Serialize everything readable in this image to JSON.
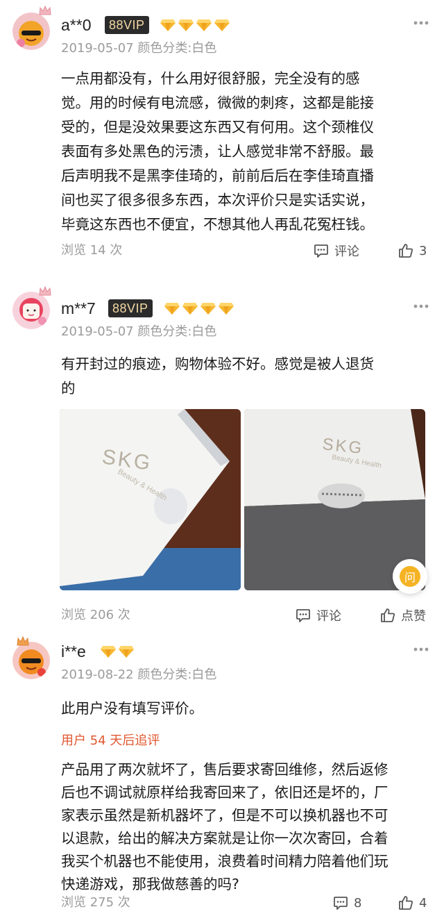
{
  "reviews": [
    {
      "username": "a**0",
      "vip_badge": "88VIP",
      "diamond_count": 4,
      "meta": "2019-05-07 颜色分类:白色",
      "lines": [
        "一点用都没有，什么用好很舒服，完全没有的感",
        "觉。用的时候有电流感，微微的刺疼，这都是能接",
        "受的，但是没效果要这东西又有何用。这个颈椎仪",
        "表面有多处黑色的污渍，让人感觉非常不舒服。最",
        "后声明我不是黑李佳琦的，前前后后在李佳琦直播",
        "间也买了很多很多东西，本次评价只是实话实说，",
        "毕竟这东西也不便宜，不想其他人再乱花冤枉钱。"
      ],
      "views": "浏览 14 次",
      "comment_label": "评论",
      "like_label": "3"
    },
    {
      "username": "m**7",
      "vip_badge": "88VIP",
      "diamond_count": 4,
      "meta": "2019-05-07 颜色分类:白色",
      "lines": [
        "有开封过的痕迹，购物体验不好。感觉是被人退货",
        "的"
      ],
      "photo_brand": "SKG",
      "photo_tagline": "Beauty & Health",
      "ask_label": "问",
      "views": "浏览 206 次",
      "comment_label": "评论",
      "like_label": "点赞"
    },
    {
      "username": "i**e",
      "diamond_count": 2,
      "meta": "2019-08-22 颜色分类:白色",
      "lines": [
        "此用户没有填写评价。"
      ],
      "followup_label": "用户 54 天后追评",
      "followup_lines": [
        "产品用了两次就坏了，售后要求寄回维修，然后返修",
        "后也不调试就原样给我寄回来了，依旧还是坏的，厂",
        "家表示虽然是新机器坏了，但是不可以换机器也不可",
        "以退款，给出的解决方案就是让你一次次寄回，合着",
        "我买个机器也不能使用，浪费着时间精力陪着他们玩",
        "快递游戏，那我做慈善的吗?"
      ],
      "views": "浏览 275 次",
      "comment_label": "8",
      "like_label": "4"
    }
  ],
  "colors": {
    "meta_gray": "#9b9b9b",
    "vip_bg": "#2b2b2b",
    "vip_text": "#f3d9a4",
    "diamond_gold": "#f5b324",
    "followup_orange": "#e0562e"
  }
}
